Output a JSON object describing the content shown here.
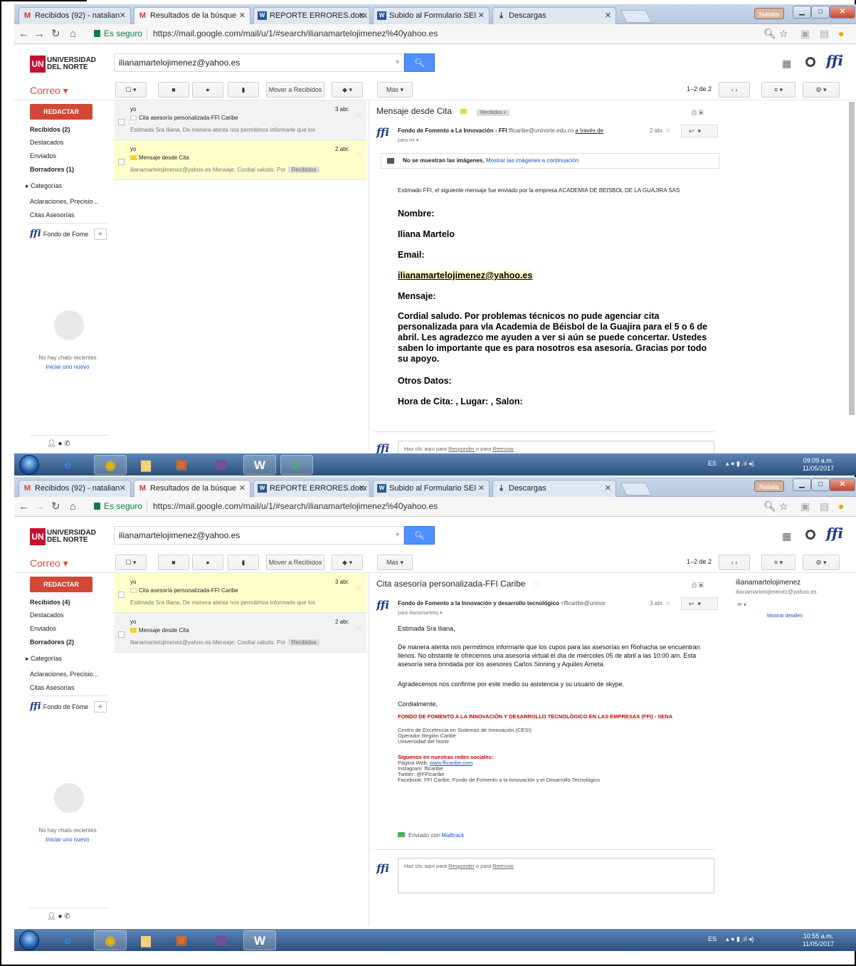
{
  "browser": {
    "tabs_1": [
      {
        "label": "Recibidos (92) - natalian",
        "icon": "gmail-icon"
      },
      {
        "label": "Resultados de la búsque",
        "icon": "gmail-icon"
      },
      {
        "label": "REPORTE ERRORES.docx",
        "icon": "word-icon"
      },
      {
        "label": "Subido al Formulario SEI",
        "icon": "word-icon"
      },
      {
        "label": "Descargas",
        "icon": "download-icon"
      }
    ],
    "tabs_2": [
      {
        "label": "Recibidos (92) - natalian",
        "icon": "gmail-icon"
      },
      {
        "label": "Resultados de la búsque",
        "icon": "gmail-icon"
      },
      {
        "label": "REPORTE ERRORES.docx",
        "icon": "word-icon"
      },
      {
        "label": "Subido al Formulario SEI",
        "icon": "word-icon"
      },
      {
        "label": "Descargas",
        "icon": "download-icon"
      }
    ],
    "profile": "Natalia",
    "secure": "Es seguro",
    "url": "https://mail.google.com/mail/u/1/#search/ilianamartelojimenez%40yahoo.es"
  },
  "gmail": {
    "logo_line1": "UNIVERSIDAD",
    "logo_line2": "DEL NORTE",
    "logo_mark": "UN",
    "search_value": "ilianamartelojimenez@yahoo.es",
    "correo": "Correo ▾",
    "move_inbox": "Mover a Recibidos",
    "more": "Más ▾",
    "page_count": "1–2 de 2",
    "compose": "REDACTAR",
    "nav_1": [
      "Recibidos (2)",
      "Destacados",
      "Enviados",
      "Borradores (1)",
      "Categorías",
      "Aclaraciones, Precisio...",
      "Citas Asesorías"
    ],
    "nav_2": [
      "Recibidos (4)",
      "Destacados",
      "Enviados",
      "Borradores (2)",
      "Categorías",
      "Aclaraciones, Precisio...",
      "Citas Asesorías"
    ],
    "hangout_name": "Fondo de Fome",
    "no_chats": "No hay chats recientes",
    "start_new": "Iniciar uno nuevo",
    "messages": [
      {
        "from": "yo",
        "date": "3 abr.",
        "subject": "Cita asesoría personalizada-FFI Caribe",
        "snippet": "Estimada Sra Iliana, De manera atenta nos permitimos informarle que los"
      },
      {
        "from": "yo",
        "date": "2 abr.",
        "subject": "Mensaje desde Cita",
        "snippet": "ilianamartelojimenez@yahoo.es Mensaje: Cordial saludo. Por",
        "tag": "Recibidos"
      }
    ]
  },
  "email1": {
    "subject": "Mensaje desde Cita",
    "chip": "Recibidos  x",
    "sender_name": "Fondo de Fomento a La Innovación - FFI",
    "sender_email": "fficaribe@uninorte.edu.co",
    "via": "a través de",
    "date": "2 abr.",
    "to": "para mí",
    "images_notice": "No se muestran las imágenes.",
    "images_link": "Mostrar las imágenes a continuación",
    "intro": "Estimado FFI, el siguiente mensaje fue enviado por la empresa ACADEMIA DE BEISBOL DE LA GUAJIRA SAS",
    "nombre_label": "Nombre:",
    "nombre": "Iliana Martelo",
    "email_label": "Email:",
    "email": "ilianamartelojimenez@yahoo.es",
    "mensaje_label": "Mensaje:",
    "mensaje": "Cordial saludo. Por problemas técnicos no pude agenciar cita personalizada para vla Academia de Béisbol de la Guajira para el 5 o 6 de abril. Les agradezco me ayuden a ver si aún se puede concertar. Ustedes saben lo importante que es para nosotros esa asesoría. Gracias por todo su apoyo.",
    "otros": "Otros Datos:",
    "hora": "Hora de Cita: , Lugar: , Salon:",
    "reply_prefix": "Haz clic aquí para",
    "reply_link": "Responder",
    "reply_or": "o para",
    "forward_link": "Reenviar"
  },
  "email2": {
    "subject": "Cita asesoría personalizada-FFI Caribe",
    "sender_name": "Fondo de Fomento a la Innovación y desarrollo tecnológico",
    "sender_email": "<fficaribe@uninor",
    "date": "3 abr.",
    "to": "para ilianamarteloj",
    "greeting": "Estimada Sra Iliana,",
    "para1": "De manera atenta nos permitimos informarle que los cupos para las asesorías en Riohacha se encuentran llenos. No obstante le ofrecemos una asesoría virtual el día de miércoles 05 de abril a las 10:00 am. Esta asesoría sera brindada por los asesores Carlos Sinning y Aquiles Arrieta.",
    "para2": "Agradecemos nos confirme por este medio su asistencia y su usuario de skype.",
    "closing": "Cordialmente,",
    "sig_org": "FONDO DE FOMENTO A LA INNOVACIÓN Y DESARROLLO TECNOLÓGICO EN LAS EMPRESAS (FFI) - SENA",
    "sig_1": "Centro de Excelencia en Sistemas de Innovación (CESI)",
    "sig_2": "Operador Región Caribe",
    "sig_3": "Universidad del Norte",
    "social_title": "Síguenos en nuestras redes sociales:",
    "web_label": "Página Web:",
    "web": "www.fficaribe.com",
    "instagram": "Instagram: fficaribe",
    "twitter": "Twitter: @FFIcaribe",
    "facebook": "Facebook: FFI Caribe, Fondo de Fomento a la Innovación y el Desarrollo Tecnológico",
    "mailtrack_prefix": "Enviado con",
    "mailtrack": "Mailtrack",
    "contact_name": "ilianamartelojimenez",
    "contact_email": "ilianamartelojimenez@yahoo.es",
    "show_details": "Mostrar detalles"
  },
  "taskbar": {
    "lang": "ES",
    "time_1": "09:09 a.m.",
    "date_1": "11/05/2017",
    "time_2": "10:55 a.m.",
    "date_2": "11/05/2017"
  }
}
